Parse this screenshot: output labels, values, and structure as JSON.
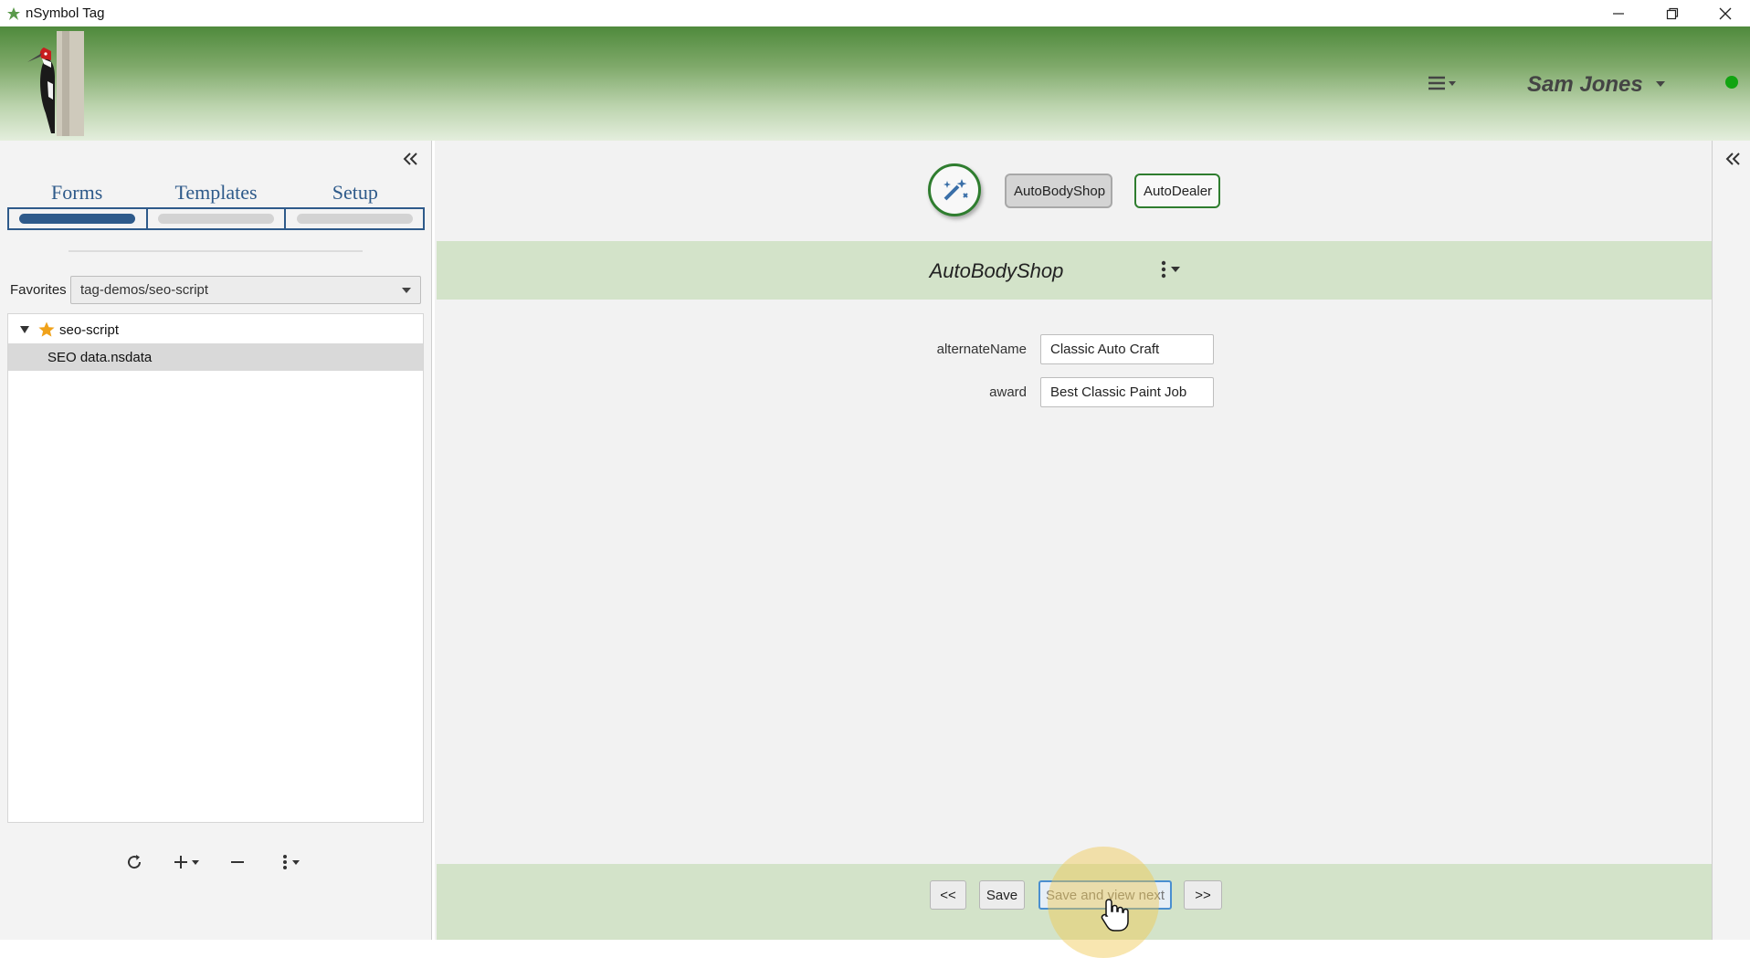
{
  "window": {
    "title": "nSymbol Tag"
  },
  "header": {
    "user_name": "Sam Jones",
    "status_color": "#12a412"
  },
  "left_panel": {
    "tabs": [
      {
        "label": "Forms",
        "active": true
      },
      {
        "label": "Templates",
        "active": false
      },
      {
        "label": "Setup",
        "active": false
      }
    ],
    "favorites_label": "Favorites",
    "favorites_value": "tag-demos/seo-script",
    "tree": {
      "root": "seo-script",
      "child": "SEO data.nsdata"
    }
  },
  "main": {
    "type_buttons": [
      "AutoBodyShop",
      "AutoDealer"
    ],
    "form_title": "AutoBodyShop",
    "fields": [
      {
        "label": "alternateName",
        "value": "Classic Auto Craft"
      },
      {
        "label": "award",
        "value": "Best Classic Paint Job"
      }
    ],
    "footer_buttons": {
      "prev": "<<",
      "save": "Save",
      "save_next": "Save and view next",
      "next": ">>"
    }
  },
  "colors": {
    "accent_blue": "#2e5a8a",
    "accent_green": "#2f7d2f",
    "form_band": "#d3e3c9"
  }
}
